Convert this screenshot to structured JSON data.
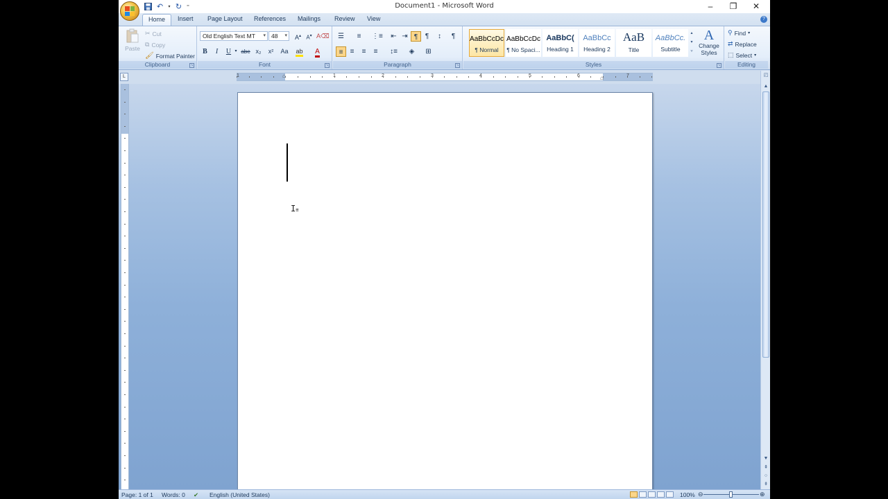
{
  "window": {
    "title": "Document1 - Microsoft Word",
    "controls": {
      "minimize": "–",
      "restore": "❐",
      "close": "✕"
    }
  },
  "qat": {
    "save_icon": "save-icon",
    "undo_icon": "undo-icon",
    "redo_icon": "redo-icon",
    "customize_icon": "customize-qat-icon"
  },
  "tabs": [
    "Home",
    "Insert",
    "Page Layout",
    "References",
    "Mailings",
    "Review",
    "View"
  ],
  "ribbon": {
    "clipboard": {
      "label": "Clipboard",
      "paste": "Paste",
      "cut": "Cut",
      "copy": "Copy",
      "format_painter": "Format Painter"
    },
    "font": {
      "label": "Font",
      "font_name": "Old English Text MT",
      "font_size": "48",
      "bold": "B",
      "italic": "I",
      "underline": "U",
      "strikethrough": "abe",
      "subscript": "x₂",
      "superscript": "x²",
      "change_case": "Aa"
    },
    "paragraph": {
      "label": "Paragraph"
    },
    "styles": {
      "label": "Styles",
      "items": [
        {
          "sample": "AaBbCcDc",
          "name": "¶ Normal"
        },
        {
          "sample": "AaBbCcDc",
          "name": "¶ No Spaci..."
        },
        {
          "sample": "AaBbC(",
          "name": "Heading 1"
        },
        {
          "sample": "AaBbCc",
          "name": "Heading 2"
        },
        {
          "sample": "AaB",
          "name": "Title"
        },
        {
          "sample": "AaBbCc.",
          "name": "Subtitle"
        }
      ],
      "change_styles": "Change Styles"
    },
    "editing": {
      "label": "Editing",
      "find": "Find",
      "replace": "Replace",
      "select": "Select"
    }
  },
  "ruler": {
    "numbers": [
      "1",
      "1",
      "2",
      "3",
      "4",
      "5",
      "6",
      "7"
    ]
  },
  "status": {
    "page": "Page: 1 of 1",
    "words": "Words: 0",
    "language": "English (United States)",
    "zoom": "100%"
  }
}
